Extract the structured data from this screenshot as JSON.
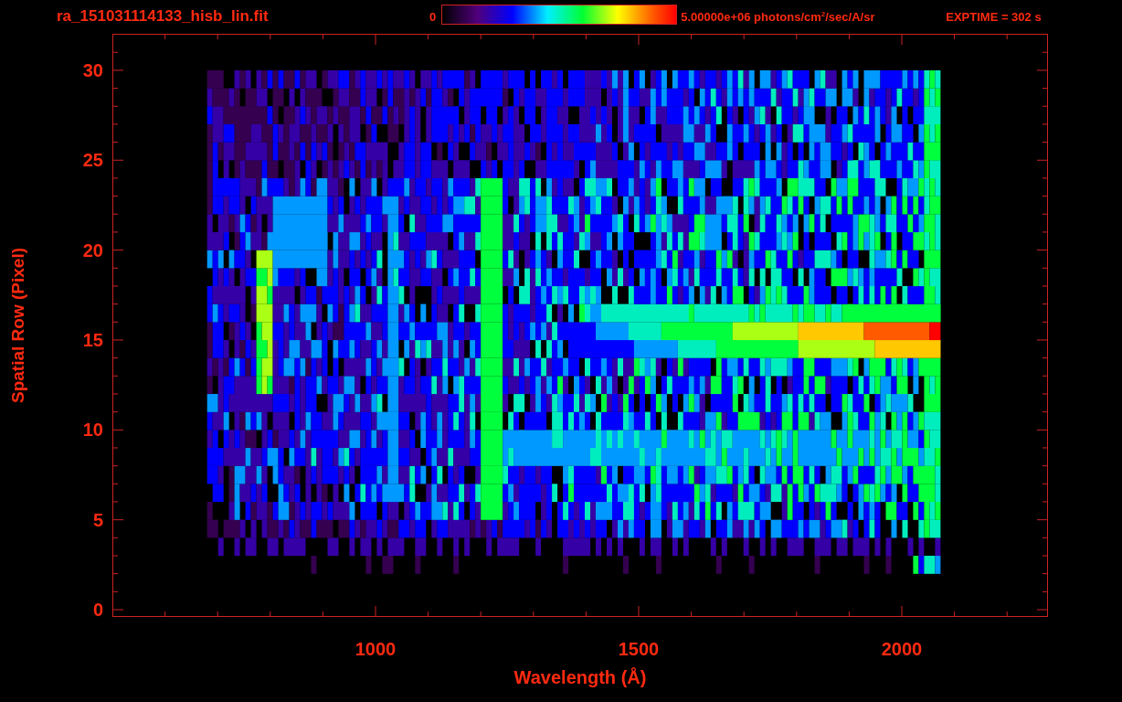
{
  "title": "ra_151031114133_hisb_lin.fit",
  "colorbar": {
    "min_label": "0",
    "max_label": "5.00000e+06 photons/cm$^{2}$/sec/A/sr"
  },
  "exposure": "EXPTIME = 302 s",
  "y_axis": {
    "title": "Spatial Row (Pixel)",
    "ticks": [
      "30",
      "25",
      "20",
      "15",
      "10",
      "5",
      "0"
    ]
  },
  "x_axis": {
    "title": "Wavelength (Å)",
    "ticks": [
      "1000",
      "1500",
      "2000"
    ]
  }
}
